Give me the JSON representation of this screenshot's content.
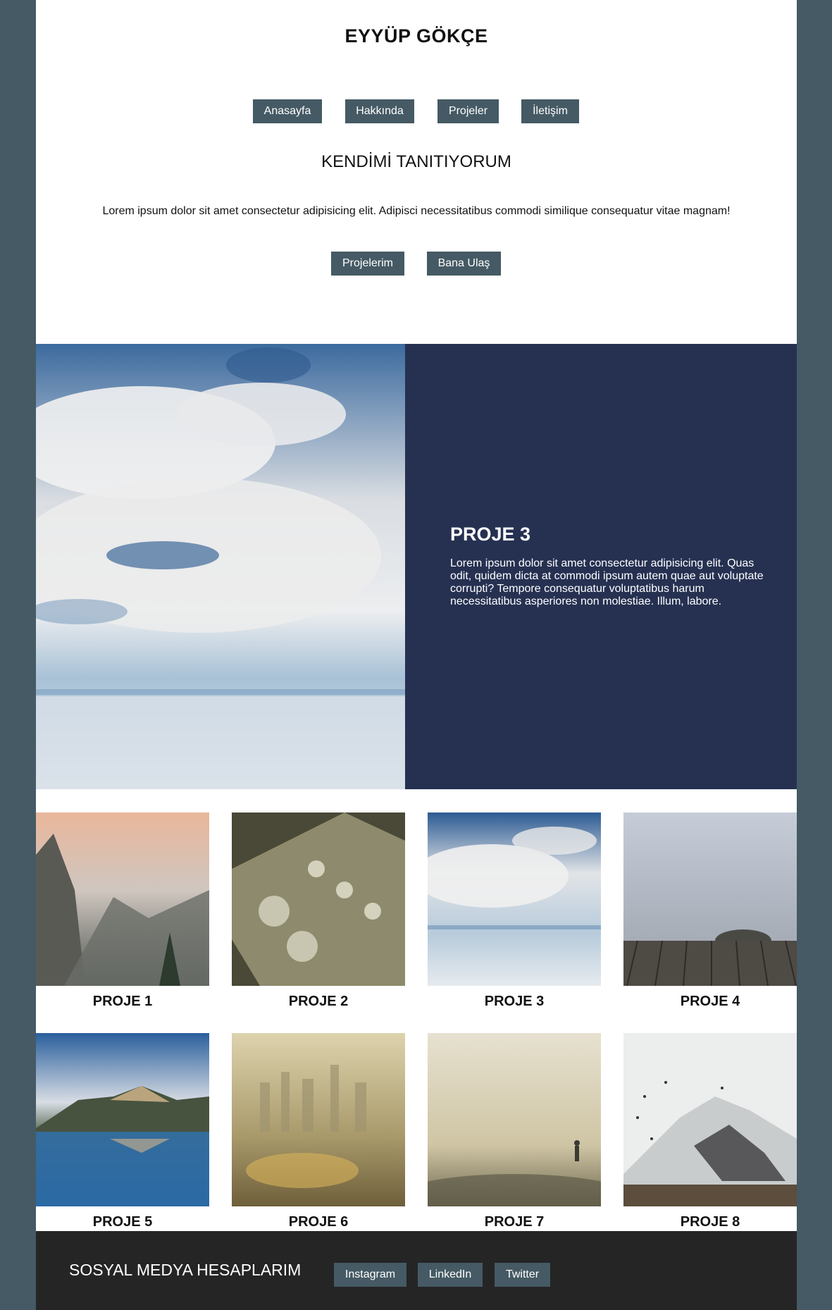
{
  "header": {
    "title": "EYYÜP GÖKÇE",
    "nav": [
      "Anasayfa",
      "Hakkında",
      "Projeler",
      "İletişim"
    ]
  },
  "intro": {
    "title": "KENDİMİ TANITIYORUM",
    "text": "Lorem ipsum dolor sit amet consectetur adipisicing elit. Adipisci necessitatibus commodi similique consequatur vitae magnam!",
    "buttons": [
      "Projelerim",
      "Bana Ulaş"
    ]
  },
  "featured": {
    "title": "PROJE 3",
    "text": "Lorem ipsum dolor sit amet consectetur adipisicing elit. Quas odit, quidem dicta at commodi ipsum autem quae aut voluptate corrupti? Tempore consequatur voluptatibus harum necessitatibus asperiores non molestiae. Illum, labore.",
    "image": "sky-clouds-reflection"
  },
  "projects": [
    {
      "title": "PROJE 1",
      "image": "mountain-valley-sunrise"
    },
    {
      "title": "PROJE 2",
      "image": "guitar-headstock"
    },
    {
      "title": "PROJE 3",
      "image": "sky-clouds-reflection"
    },
    {
      "title": "PROJE 4",
      "image": "wooden-dock-fog"
    },
    {
      "title": "PROJE 5",
      "image": "mountain-lake-reflection"
    },
    {
      "title": "PROJE 6",
      "image": "foggy-city-skyline"
    },
    {
      "title": "PROJE 7",
      "image": "person-in-fog"
    },
    {
      "title": "PROJE 8",
      "image": "snowy-mountain-birds"
    }
  ],
  "footer": {
    "title": "SOSYAL MEDYA HESAPLARIM",
    "links": [
      "Instagram",
      "LinkedIn",
      "Twitter"
    ]
  },
  "colors": {
    "background": "#455a64",
    "button": "#455a64",
    "featured_panel": "#263152",
    "footer": "#252525"
  }
}
